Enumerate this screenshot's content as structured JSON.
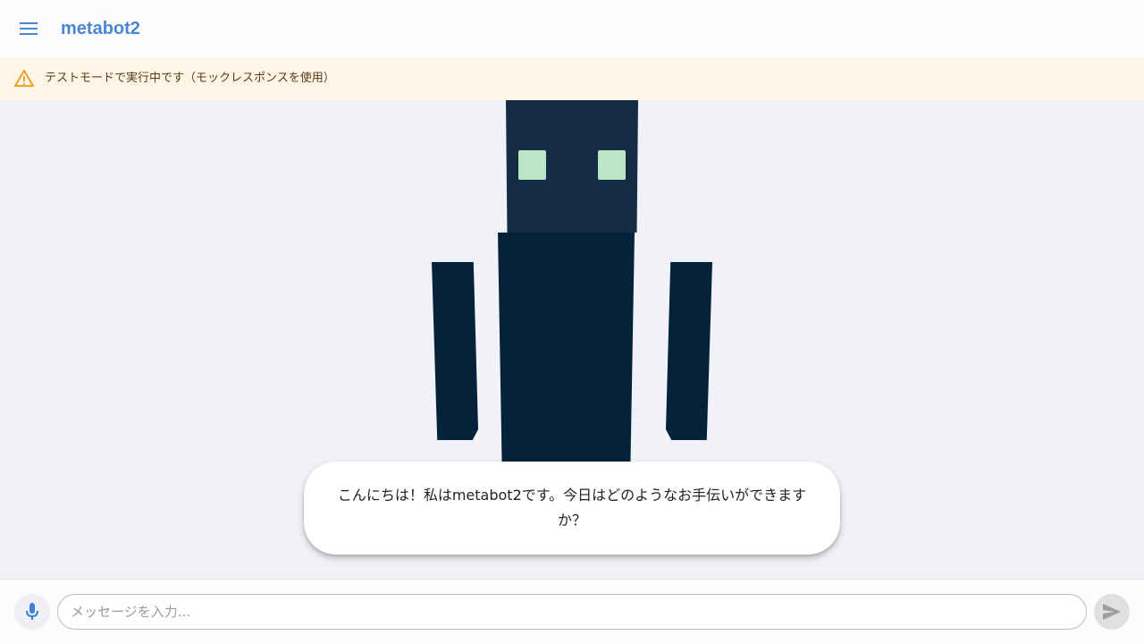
{
  "app_bar": {
    "title": "metabot2",
    "menu_icon": "hamburger-menu-icon"
  },
  "banner": {
    "icon": "warning-icon",
    "text": "テストモードで実行中です（モックレスポンスを使用）",
    "accent_color": "#f0a030"
  },
  "robot": {
    "head_color": "#142d45",
    "body_color": "#04223a",
    "eye_color": "#bce5c6"
  },
  "speech_bubble": {
    "text": "こんにちは！私はmetabot2です。今日はどのようなお手伝いができますか？"
  },
  "composer": {
    "mic_icon": "microphone-icon",
    "input_value": "",
    "input_placeholder": "メッセージを入力...",
    "send_icon": "send-icon"
  },
  "colors": {
    "brand": "#4a86d4",
    "background": "#f0f2f7",
    "banner_bg": "#fff5e6"
  }
}
